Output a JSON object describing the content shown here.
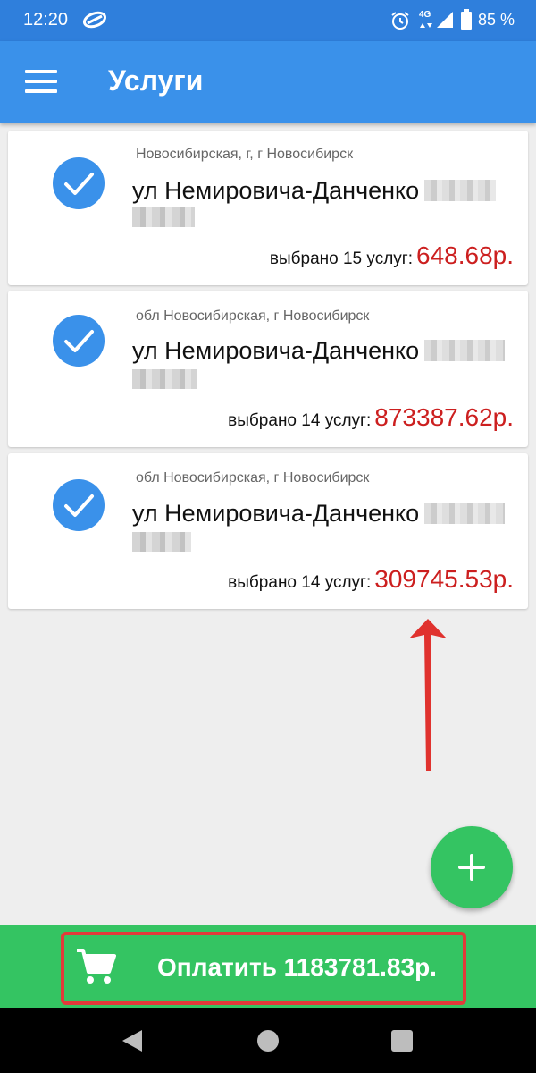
{
  "status_bar": {
    "time": "12:20",
    "network": "4G",
    "battery": "85 %",
    "icons": [
      "app-logo-icon",
      "alarm-icon",
      "data-arrows-icon",
      "signal-icon",
      "battery-icon"
    ]
  },
  "app_bar": {
    "title": "Услуги",
    "menu_icon": "hamburger-menu-icon"
  },
  "services": [
    {
      "region": "Новосибирская,  г, г Новосибирск",
      "street": "ул Немировича-Данченко",
      "count_label": "выбрано 15 услуг:",
      "amount": "648.68р.",
      "checked": true
    },
    {
      "region": "обл Новосибирская, г Новосибирск",
      "street": "ул Немировича-Данченко",
      "count_label": "выбрано 14 услуг:",
      "amount": "873387.62р.",
      "checked": true
    },
    {
      "region": "обл Новосибирская, г Новосибирск",
      "street": "ул Немировича-Данченко",
      "count_label": "выбрано 14 услуг:",
      "amount": "309745.53р.",
      "checked": true
    }
  ],
  "fab": {
    "icon": "plus-icon"
  },
  "pay": {
    "label": "Оплатить 1183781.83р.",
    "icon": "cart-icon"
  },
  "colors": {
    "status_bar": "#2f7fdc",
    "app_bar": "#3a91ea",
    "accent_green": "#34c462",
    "amount_red": "#cc1f1f",
    "highlight_red": "#e23a3a"
  }
}
